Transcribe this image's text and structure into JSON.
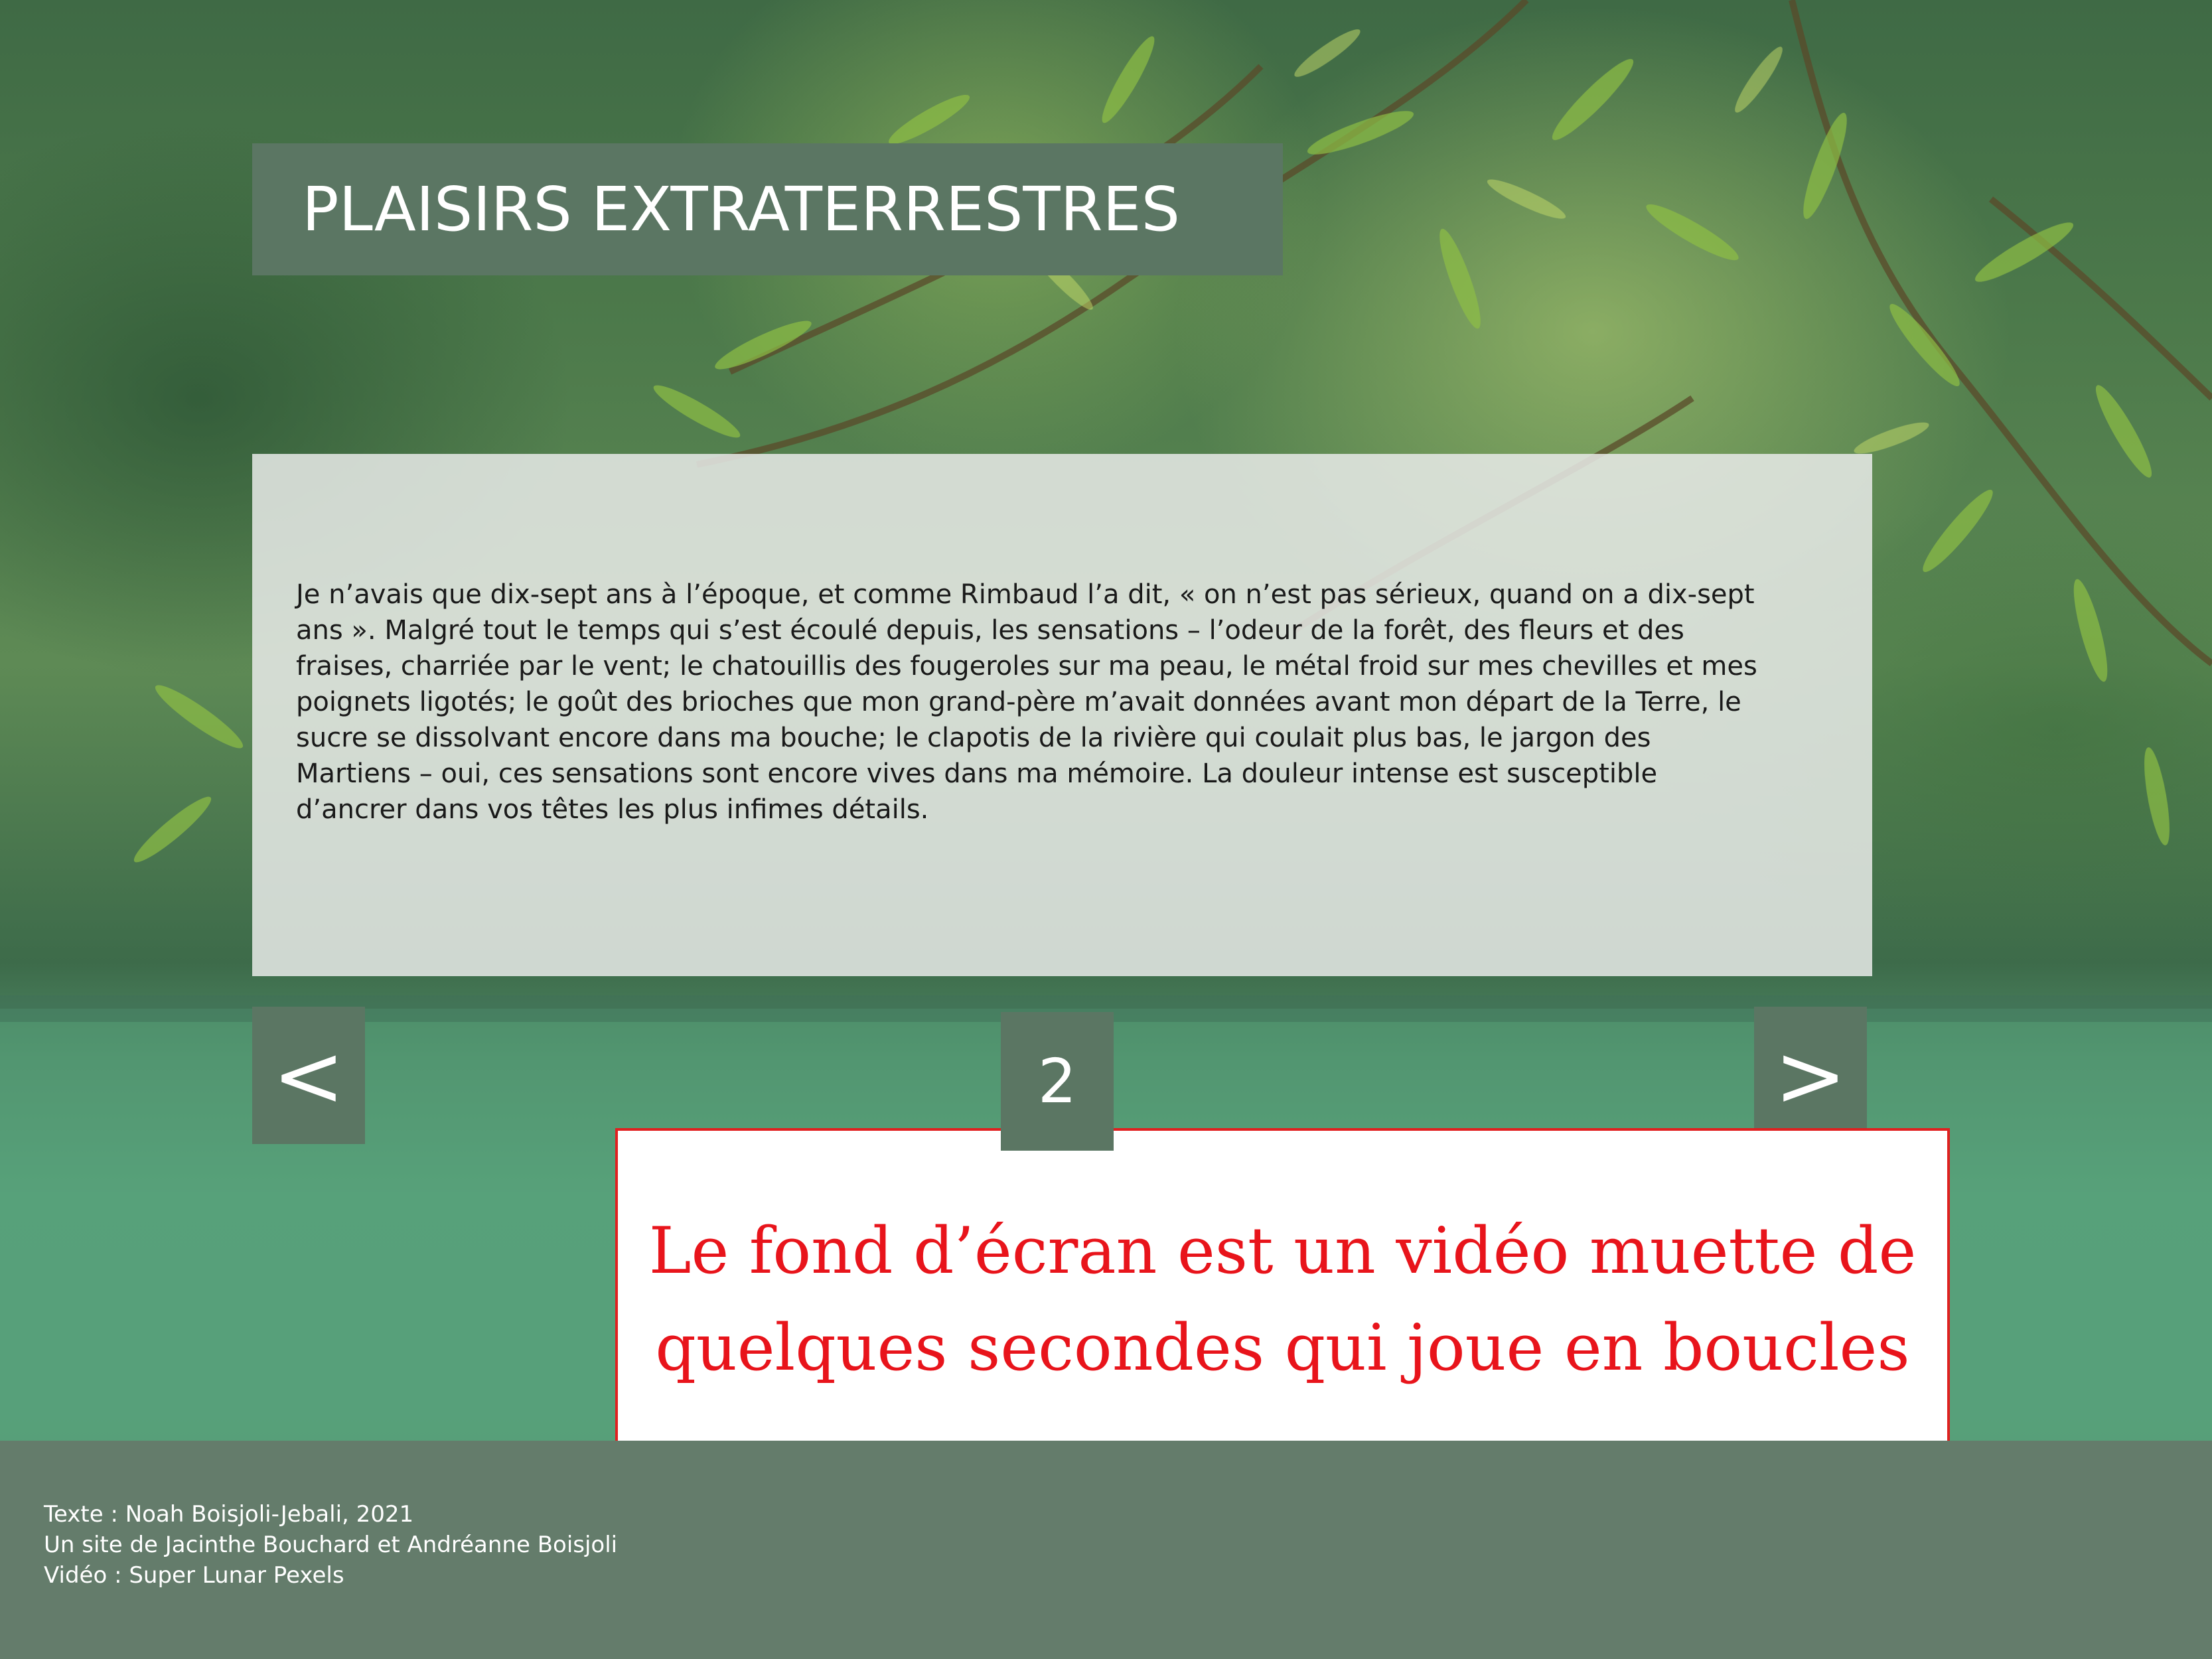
{
  "page": {
    "title": "PLAISIRS EXTRATERRESTRES"
  },
  "story": {
    "text": "Je n’avais que dix-sept ans à l’époque, et comme Rimbaud l’a dit, « on n’est pas sérieux, quand on a dix-sept ans ». Malgré tout le temps qui s’est écoulé depuis, les sensations – l’odeur de la forêt, des fleurs et des fraises, charriée par le vent; le chatouillis des fougeroles sur ma peau, le métal froid sur mes chevilles et mes poignets ligotés; le goût des brioches que mon grand-père m’avait données avant mon départ de la Terre, le sucre se dissolvant encore dans ma bouche; le clapotis de la rivière qui coulait plus bas, le jargon des Martiens – oui, ces sensations sont encore vives dans ma mémoire. La douleur intense est susceptible d’ancrer dans vos têtes les plus infimes détails."
  },
  "nav": {
    "prev_label": "<",
    "page_number": "2",
    "next_label": ">"
  },
  "note": {
    "line1": "Le fond d’écran est un vidéo muette de",
    "line2": "quelques secondes qui joue en boucles"
  },
  "footer": {
    "lines": [
      "Texte : Noah Boisjoli-Jebali, 2021",
      "Un site de Jacinthe Bouchard et Andréanne Boisjoli",
      "Vidéo : Super Lunar Pexels"
    ]
  },
  "colors": {
    "panel_green": "#5b7663",
    "footer_green": "#647c6b",
    "note_red": "#e8141b"
  }
}
